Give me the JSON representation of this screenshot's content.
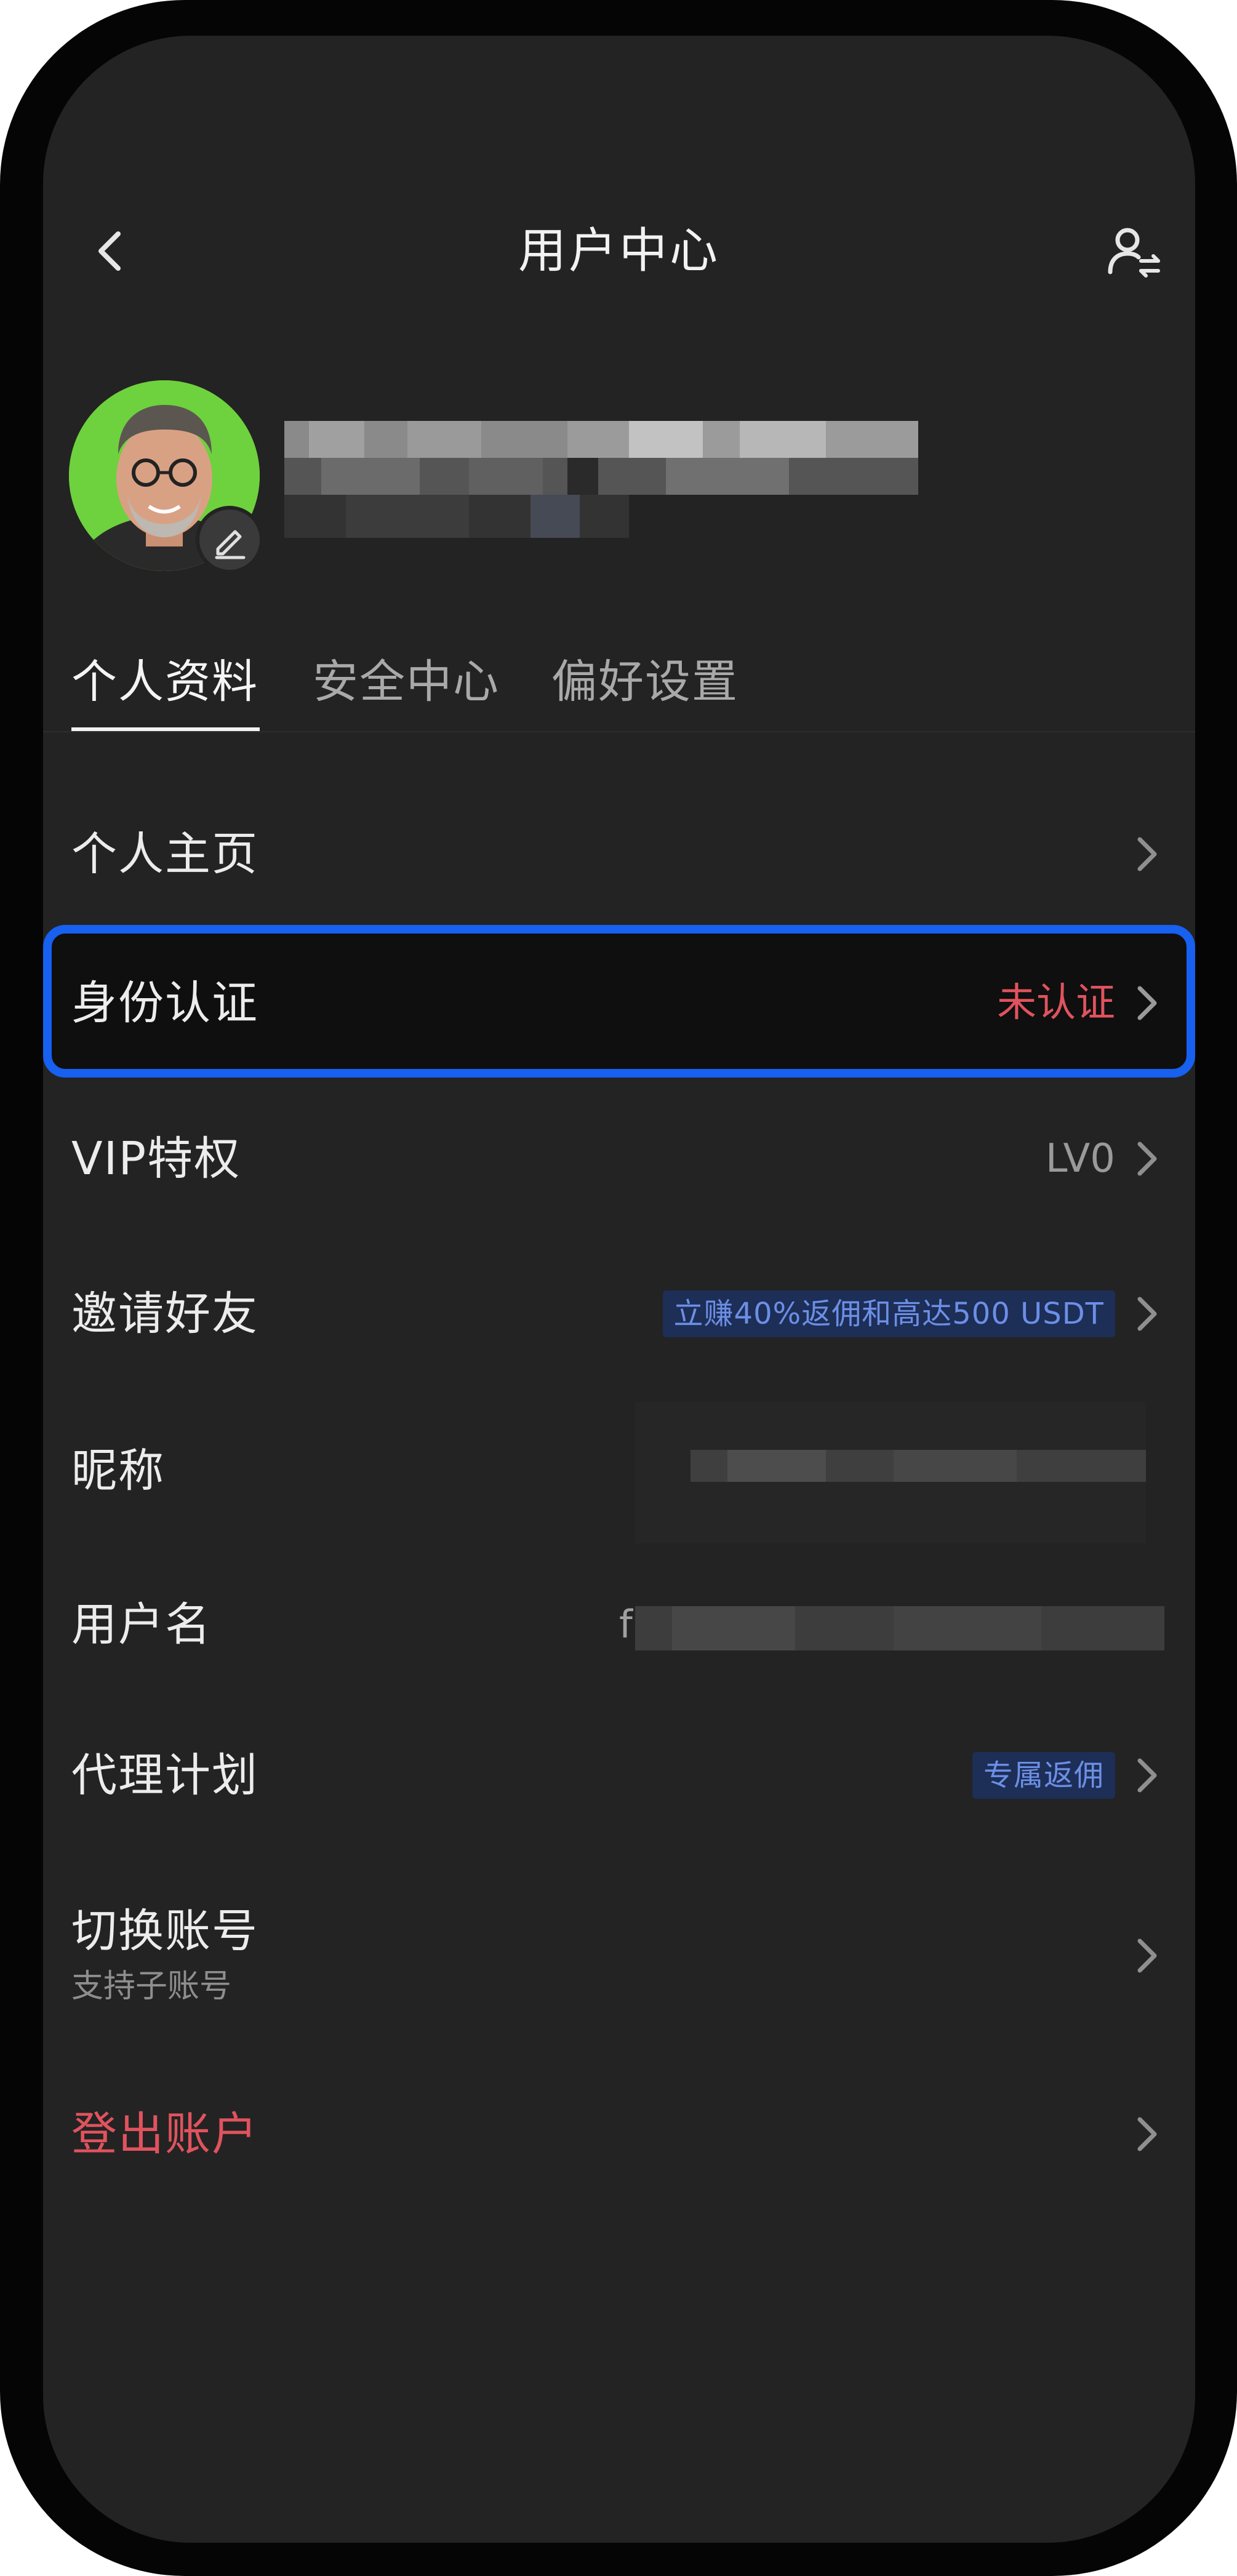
{
  "header": {
    "title": "用户中心",
    "back_icon": "chevron-left-icon",
    "switch_account_icon": "user-switch-icon"
  },
  "profile": {
    "avatar_bg": "#6ed13e",
    "edit_icon": "pencil-icon"
  },
  "tabs": [
    {
      "label": "个人资料",
      "active": true
    },
    {
      "label": "安全中心",
      "active": false
    },
    {
      "label": "偏好设置",
      "active": false
    }
  ],
  "menu": {
    "homepage": {
      "label": "个人主页"
    },
    "identity": {
      "label": "身份认证",
      "value": "未认证"
    },
    "vip": {
      "label": "VIP特权",
      "value": "LV0"
    },
    "invite": {
      "label": "邀请好友",
      "badge": "立赚40%返佣和高达500 USDT"
    },
    "nickname": {
      "label": "昵称"
    },
    "username": {
      "label": "用户名",
      "value_prefix": "f"
    },
    "agent": {
      "label": "代理计划",
      "badge": "专属返佣"
    },
    "switch_account": {
      "label": "切换账号",
      "sub": "支持子账号"
    },
    "logout": {
      "label": "登出账户"
    }
  },
  "colors": {
    "accent_blue": "#1760f0",
    "danger_red": "#e0535e",
    "badge_bg": "#1d2e57",
    "badge_text": "#6c8fe6",
    "screen_bg": "#232323"
  }
}
